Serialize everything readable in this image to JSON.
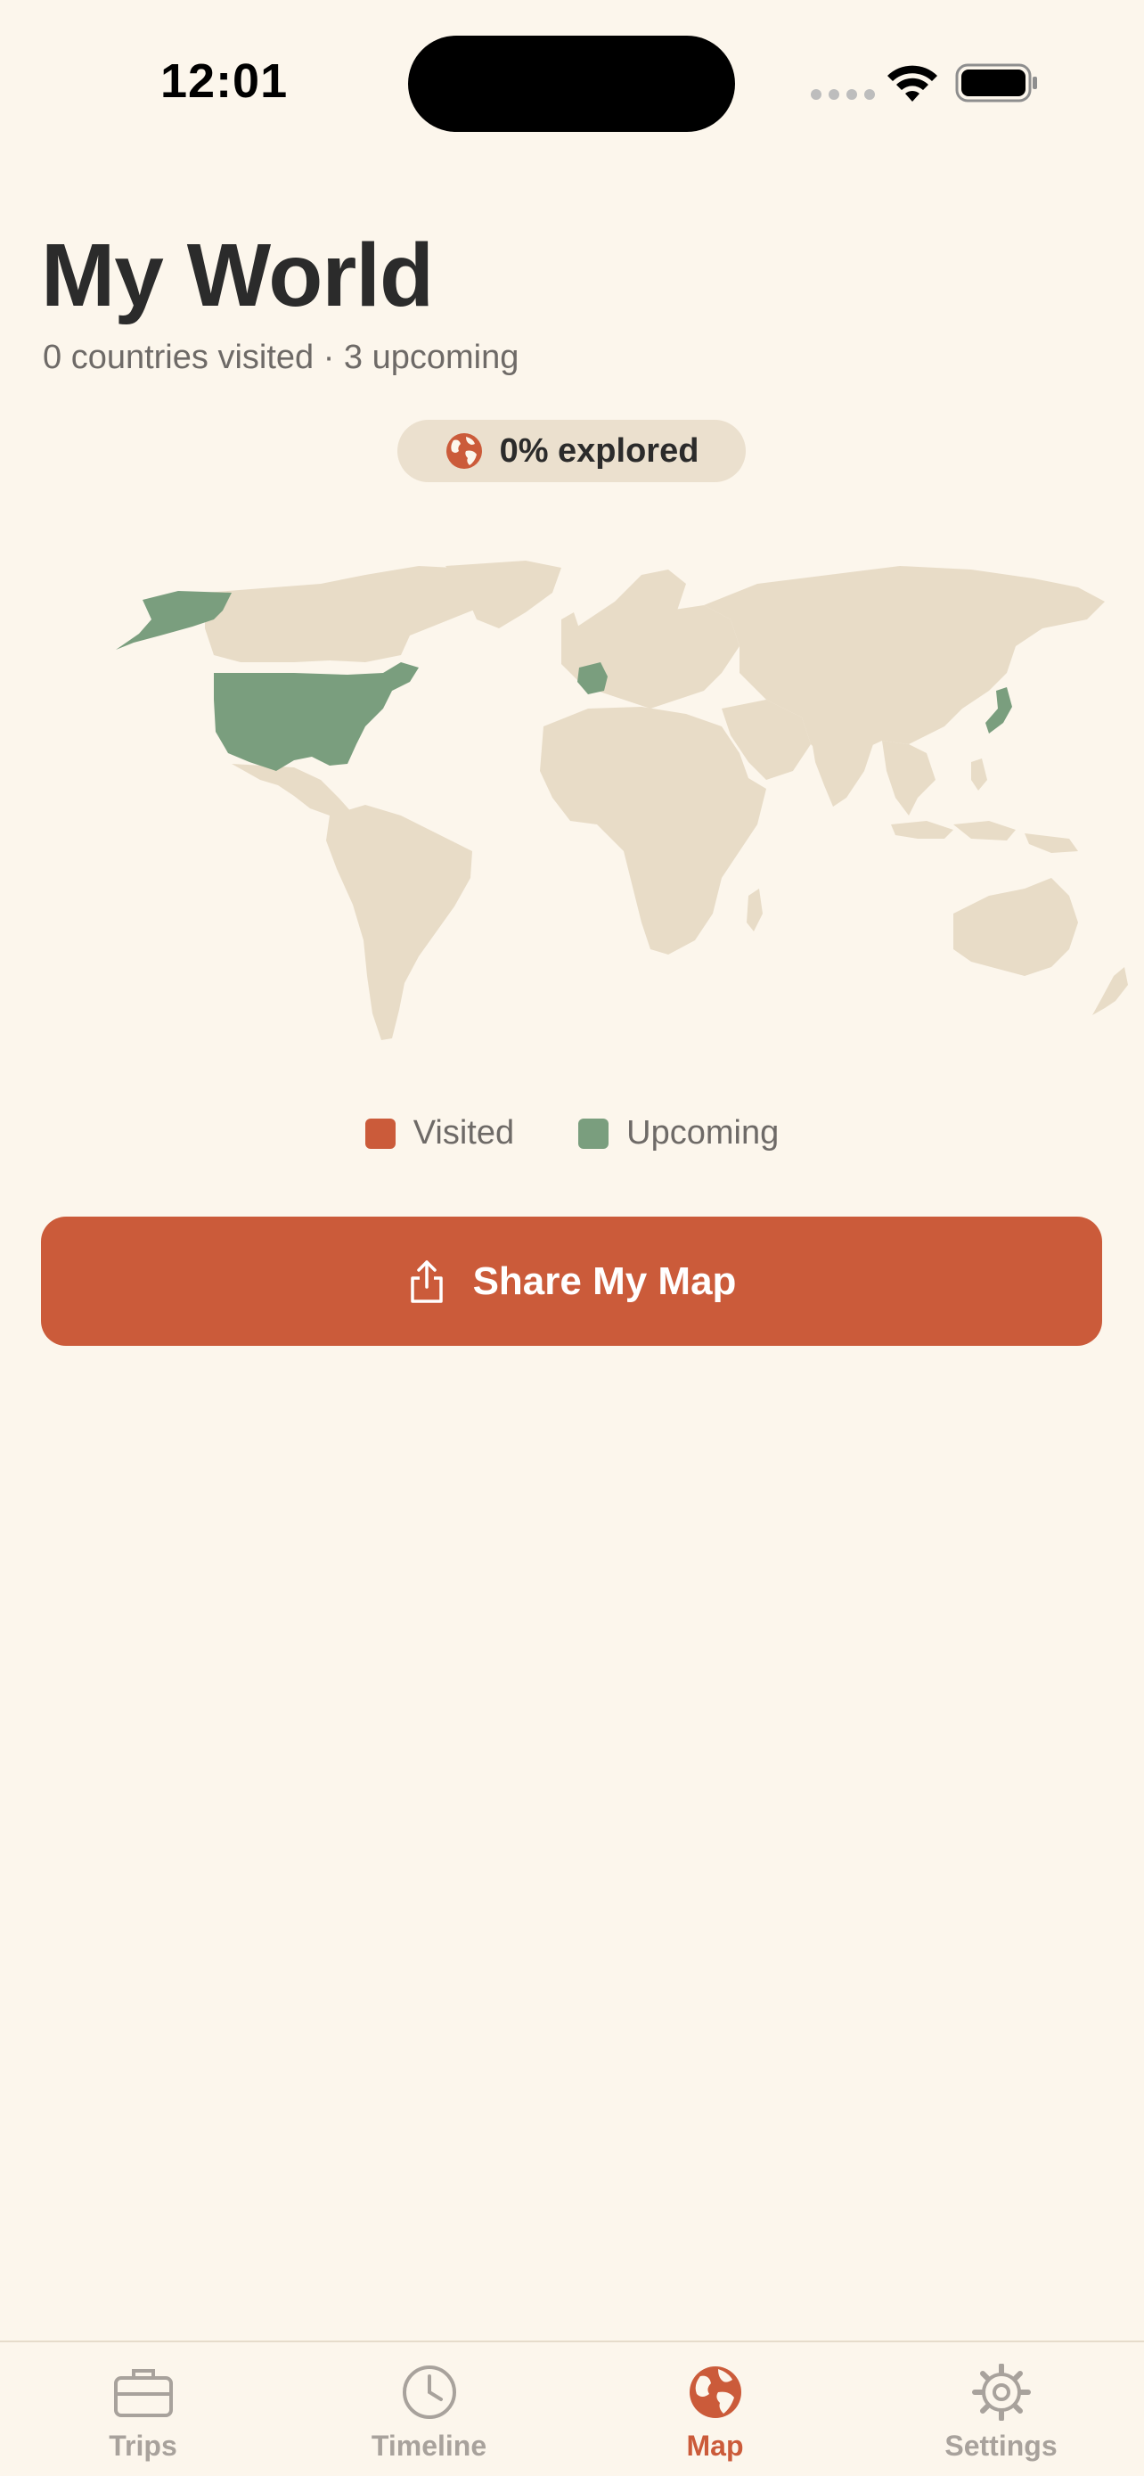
{
  "status_bar": {
    "time": "12:01"
  },
  "header": {
    "title": "My World",
    "subtitle": "0 countries visited · 3 upcoming"
  },
  "explored": {
    "label": "0% explored",
    "icon": "globe-icon"
  },
  "map": {
    "upcoming_countries_highlighted": 3,
    "visited_countries_highlighted": 0
  },
  "legend": {
    "visited_label": "Visited",
    "upcoming_label": "Upcoming"
  },
  "share_button": {
    "label": "Share My Map",
    "icon": "share-icon"
  },
  "tabs": [
    {
      "label": "Trips",
      "icon": "briefcase-icon",
      "active": false
    },
    {
      "label": "Timeline",
      "icon": "clock-icon",
      "active": false
    },
    {
      "label": "Map",
      "icon": "globe-icon",
      "active": true
    },
    {
      "label": "Settings",
      "icon": "gear-icon",
      "active": false
    }
  ],
  "colors": {
    "background": "#FCF6EC",
    "accent": "#CB5B3A",
    "visited": "#CB5B3A",
    "upcoming": "#7A9E7E",
    "land": "#E8DCC7",
    "pill": "#EBE0CE",
    "muted_text": "#6E6A67",
    "inactive_tab": "#A8A29C"
  }
}
